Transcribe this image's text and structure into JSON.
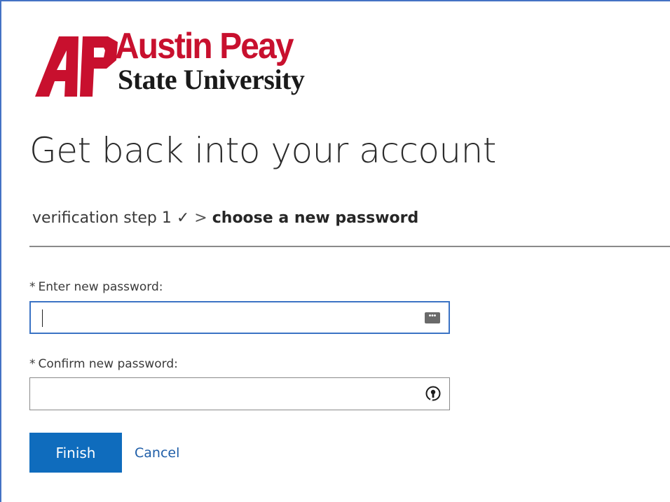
{
  "branding": {
    "logo_letters": "AP",
    "logo_name": "Austin Peay",
    "logo_subtitle": "State University",
    "brand_color": "#c8102e"
  },
  "page": {
    "title": "Get back into your account"
  },
  "breadcrumb": {
    "step1": "verification step 1",
    "step1_check": "✓",
    "separator": ">",
    "current": "choose a new password"
  },
  "form": {
    "new_password": {
      "required_marker": "*",
      "label": "Enter new password:",
      "value": "",
      "icon": "password-manager-icon",
      "focused": true
    },
    "confirm_password": {
      "required_marker": "*",
      "label": "Confirm new password:",
      "value": "",
      "icon": "password-key-icon"
    }
  },
  "actions": {
    "finish_label": "Finish",
    "cancel_label": "Cancel",
    "primary_color": "#0f6cbd"
  }
}
